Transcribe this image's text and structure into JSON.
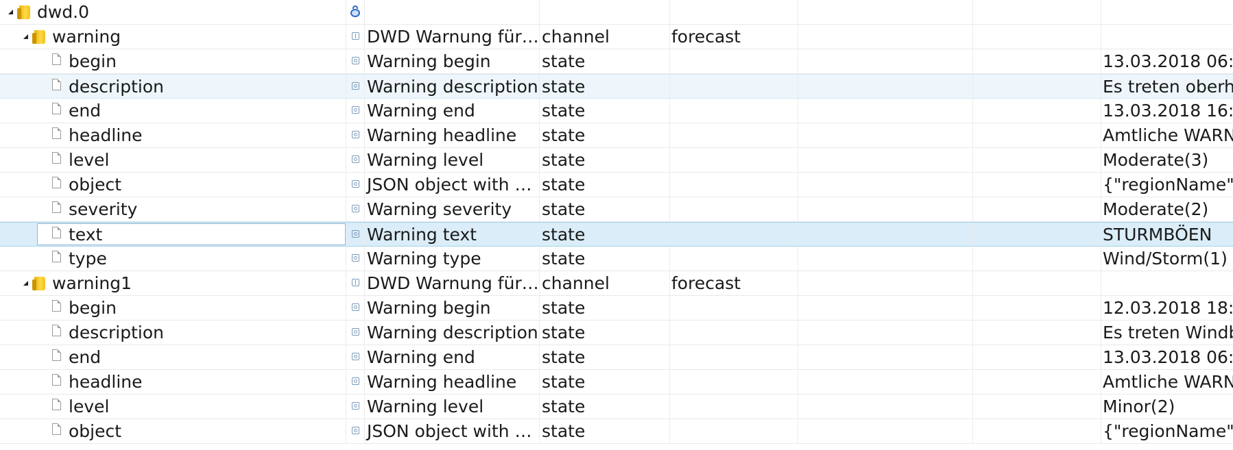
{
  "rows": [
    {
      "name": "dwd.0",
      "desc": "",
      "type": "",
      "role": "",
      "value": "",
      "kind": "folder",
      "level": 0,
      "icon": "adapter-icon"
    },
    {
      "name": "warning",
      "desc": "DWD Warnung für ...",
      "type": "channel",
      "role": "forecast",
      "value": "",
      "kind": "folder",
      "level": 1,
      "icon": "channel-icon"
    },
    {
      "name": "begin",
      "desc": "Warning begin",
      "type": "state",
      "role": "",
      "value": "13.03.2018 06:",
      "kind": "file",
      "level": 2,
      "icon": "state-icon"
    },
    {
      "name": "description",
      "desc": "Warning description",
      "type": "state",
      "role": "",
      "value": "Es treten oberh",
      "kind": "file",
      "level": 2,
      "icon": "state-icon"
    },
    {
      "name": "end",
      "desc": "Warning end",
      "type": "state",
      "role": "",
      "value": "13.03.2018 16:",
      "kind": "file",
      "level": 2,
      "icon": "state-icon"
    },
    {
      "name": "headline",
      "desc": "Warning headline",
      "type": "state",
      "role": "",
      "value": "Amtliche WARN",
      "kind": "file",
      "level": 2,
      "icon": "state-icon"
    },
    {
      "name": "level",
      "desc": "Warning level",
      "type": "state",
      "role": "",
      "value": "Moderate(3)",
      "kind": "file",
      "level": 2,
      "icon": "state-icon"
    },
    {
      "name": "object",
      "desc": "JSON object with w...",
      "type": "state",
      "role": "",
      "value": "{\"regionName\":",
      "kind": "file",
      "level": 2,
      "icon": "state-icon"
    },
    {
      "name": "severity",
      "desc": "Warning severity",
      "type": "state",
      "role": "",
      "value": "Moderate(2)",
      "kind": "file",
      "level": 2,
      "icon": "state-icon"
    },
    {
      "name": "text",
      "desc": "Warning text",
      "type": "state",
      "role": "",
      "value": "STURMBÖEN",
      "kind": "file",
      "level": 2,
      "icon": "state-icon"
    },
    {
      "name": "type",
      "desc": "Warning type",
      "type": "state",
      "role": "",
      "value": "Wind/Storm(1)",
      "kind": "file",
      "level": 2,
      "icon": "state-icon"
    },
    {
      "name": "warning1",
      "desc": "DWD Warnung für ...",
      "type": "channel",
      "role": "forecast",
      "value": "",
      "kind": "folder",
      "level": 1,
      "icon": "channel-icon"
    },
    {
      "name": "begin",
      "desc": "Warning begin",
      "type": "state",
      "role": "",
      "value": "12.03.2018 18:",
      "kind": "file",
      "level": 2,
      "icon": "state-icon"
    },
    {
      "name": "description",
      "desc": "Warning description",
      "type": "state",
      "role": "",
      "value": "Es treten Windb",
      "kind": "file",
      "level": 2,
      "icon": "state-icon"
    },
    {
      "name": "end",
      "desc": "Warning end",
      "type": "state",
      "role": "",
      "value": "13.03.2018 06:",
      "kind": "file",
      "level": 2,
      "icon": "state-icon"
    },
    {
      "name": "headline",
      "desc": "Warning headline",
      "type": "state",
      "role": "",
      "value": "Amtliche WARN",
      "kind": "file",
      "level": 2,
      "icon": "state-icon"
    },
    {
      "name": "level",
      "desc": "Warning level",
      "type": "state",
      "role": "",
      "value": "Minor(2)",
      "kind": "file",
      "level": 2,
      "icon": "state-icon"
    },
    {
      "name": "object",
      "desc": "JSON object with w...",
      "type": "state",
      "role": "",
      "value": "{\"regionName\":",
      "kind": "file",
      "level": 2,
      "icon": "state-icon"
    }
  ],
  "hover_row": "warning.description",
  "selected_row": "warning.text",
  "colors": {
    "hover": "#eef6fb",
    "selected": "#daedf8",
    "folder": "#f4c21a",
    "adapter": "#2c67c9"
  }
}
